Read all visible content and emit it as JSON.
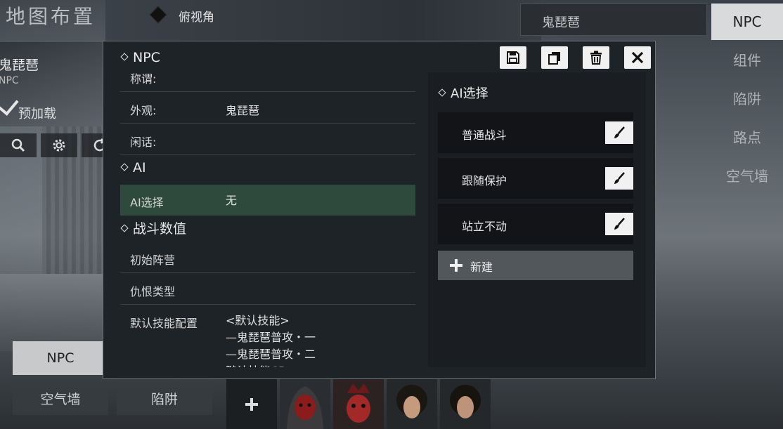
{
  "map": {
    "title": "地图布置",
    "view_mode": "俯视角"
  },
  "search": {
    "value": "鬼琵琶"
  },
  "npc_info": {
    "name": "鬼琵琶",
    "sub": "NPC",
    "preload_label": "预加载"
  },
  "right_tabs": [
    {
      "label": "NPC",
      "active": true
    },
    {
      "label": "组件"
    },
    {
      "label": "陷阱"
    },
    {
      "label": "路点"
    },
    {
      "label": "空气墙"
    }
  ],
  "bottom": {
    "npc_label": "NPC",
    "airwall_label": "空气墙",
    "trap_label": "陷阱",
    "add_symbol": "+"
  },
  "dialog": {
    "title": "NPC",
    "left": {
      "rows": {
        "name": {
          "label": "称谓:",
          "value": ""
        },
        "appearance": {
          "label": "外观:",
          "value": "鬼琵琶"
        },
        "idle": {
          "label": "闲话:",
          "value": ""
        }
      },
      "section_ai": "AI",
      "ai_select": {
        "label": "AI选择",
        "value": "无"
      },
      "section_combat": "战斗数值",
      "initial_camp": {
        "label": "初始阵营"
      },
      "hate_type": {
        "label": "仇恨类型"
      },
      "default_skill": {
        "label": "默认技能配置",
        "lines": "<默认技能>\n—鬼琵琶普攻・一\n—鬼琵琶普攻・二\n默认技能CD:"
      }
    },
    "right": {
      "header": "AI选择",
      "items": [
        "普通战斗",
        "跟随保护",
        "站立不动"
      ],
      "new_label": "新建"
    }
  },
  "colors": {
    "selected_row": "#2e4a3d",
    "dialog_bg": "#1e2327",
    "active_tab": "#d9dadb"
  }
}
